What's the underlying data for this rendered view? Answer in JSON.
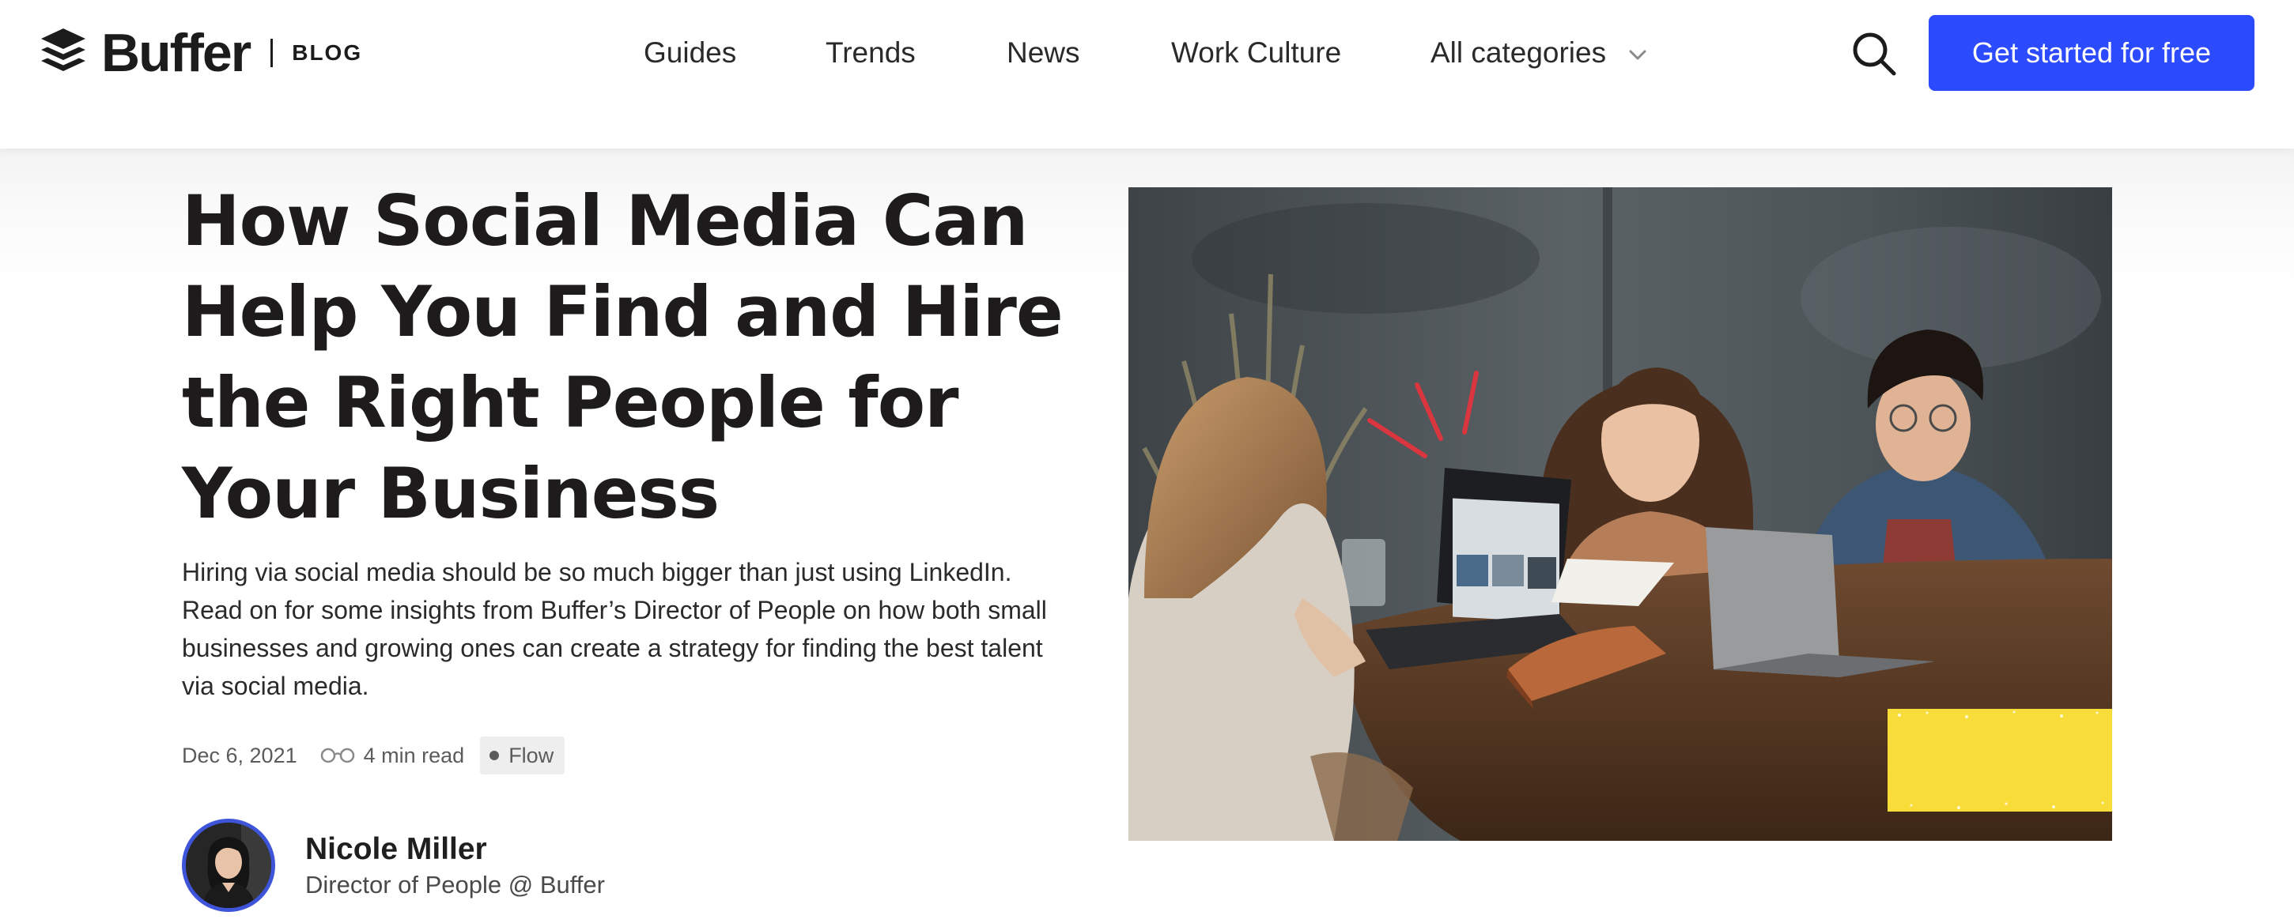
{
  "header": {
    "logo_text": "Buffer",
    "logo_section": "BLOG",
    "nav": [
      {
        "label": "Guides"
      },
      {
        "label": "Trends"
      },
      {
        "label": "News"
      },
      {
        "label": "Work Culture"
      },
      {
        "label": "All categories"
      }
    ],
    "cta_label": "Get started for free",
    "icons": {
      "logo": "buffer-logo-icon",
      "dropdown": "chevron-down-icon",
      "search": "search-icon"
    }
  },
  "article": {
    "title": "How Social Media Can Help You Find and Hire the Right People for Your Business",
    "excerpt": "Hiring via social media should be so much bigger than just using LinkedIn. Read on for some insights from Buffer’s Director of People on how both small businesses and growing ones can create a strategy for finding the best talent via social media.",
    "date": "Dec 6, 2021",
    "read_time": "4 min read",
    "tag": "Flow",
    "author": {
      "name": "Nicole Miller",
      "role": "Director of People @ Buffer"
    },
    "hero_image": "three people laughing around a table with laptops"
  },
  "colors": {
    "accent": "#2c4bff",
    "text": "#1d1b1c",
    "muted": "#5b5b5b",
    "tag_bg": "#eeeeee",
    "avatar_ring": "#3f55d9",
    "highlight": "#f7dc3a"
  }
}
